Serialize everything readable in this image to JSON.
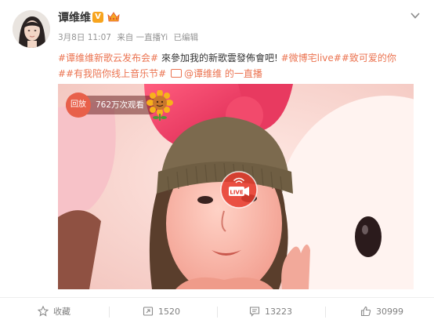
{
  "post": {
    "author": "谭维维",
    "verified_badge": "V",
    "timestamp": "3月8日 11:07",
    "source": "来自 一直播Yi",
    "edited": "已编辑",
    "topic_1": "#谭维维新歌云发布会#",
    "text_1": " 來參加我的新歌雲發佈會吧! ",
    "topic_2": "#微博宅live#",
    "topic_3": "#致可爱的你",
    "topic_4": "##有我陪你线上音乐节#",
    "mention": "@谭维维",
    "mention_suffix": " 的一直播"
  },
  "video": {
    "replay_label": "回放",
    "views": "762万次观看",
    "live_label": "LIVE"
  },
  "actions": {
    "favorite": "收藏",
    "repost": "1520",
    "comment": "13223",
    "like": "30999"
  },
  "colors": {
    "link": "#eb7350",
    "meta": "#939393",
    "live_red": "#e63b2e"
  }
}
